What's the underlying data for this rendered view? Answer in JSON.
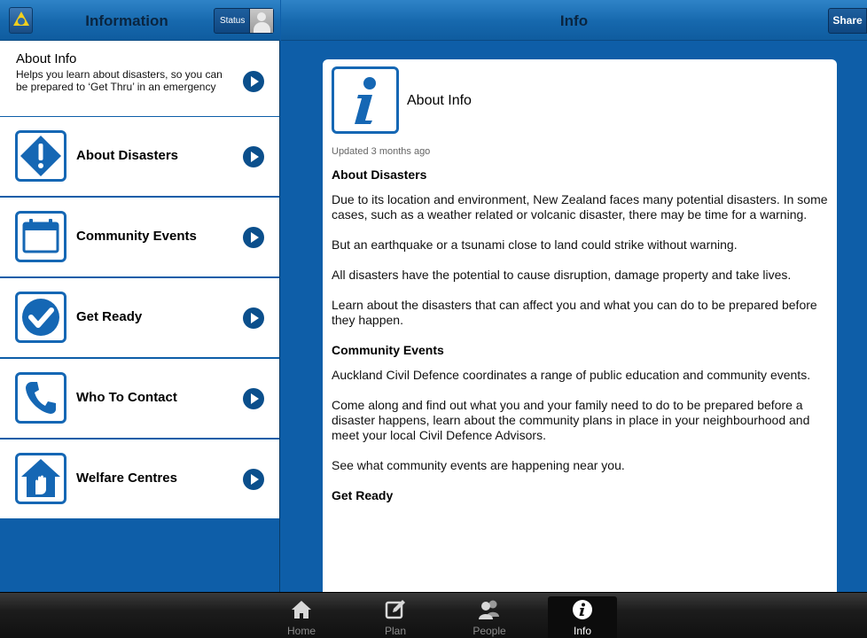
{
  "left_header": {
    "title": "Information",
    "status_label": "Status"
  },
  "intro": {
    "title": "About Info",
    "description": "Helps you learn about disasters, so you can be prepared to ‘Get Thru’ in an emergency"
  },
  "menu": [
    {
      "label": "About Disasters",
      "icon": "warning-diamond-icon"
    },
    {
      "label": "Community Events",
      "icon": "calendar-icon"
    },
    {
      "label": "Get Ready",
      "icon": "checkmark-icon"
    },
    {
      "label": "Who To Contact",
      "icon": "phone-icon"
    },
    {
      "label": "Welfare Centres",
      "icon": "house-hand-icon"
    }
  ],
  "right_header": {
    "title": "Info",
    "share_label": "Share"
  },
  "content": {
    "title": "About Info",
    "updated": "Updated 3 months ago",
    "sections": [
      {
        "heading": "About Disasters",
        "paragraphs": [
          "Due to its location and environment, New Zealand faces many potential disasters. In some cases, such as a weather related or volcanic disaster, there may be time for a warning.",
          "But an earthquake or a tsunami close to land could strike without warning.",
          "All disasters have the potential to cause disruption, damage property and take lives.",
          "Learn about the disasters that can affect you and what you can do to be prepared before they happen."
        ]
      },
      {
        "heading": "Community Events",
        "paragraphs": [
          "Auckland Civil Defence coordinates a range of public education and community events.",
          "Come along and find out what you and your family need to do to be prepared before a disaster happens, learn about the community plans in place in your neighbourhood and meet your local Civil Defence Advisors.",
          "See what community events are happening near you."
        ]
      },
      {
        "heading": "Get Ready",
        "paragraphs": []
      }
    ]
  },
  "tabbar": {
    "tabs": [
      {
        "label": "Home",
        "icon": "home-icon"
      },
      {
        "label": "Plan",
        "icon": "pencil-square-icon"
      },
      {
        "label": "People",
        "icon": "people-icon"
      },
      {
        "label": "Info",
        "icon": "info-icon"
      }
    ],
    "active": "Info"
  },
  "colors": {
    "brand_blue": "#1567b4",
    "background_blue": "#0e5ea8",
    "chevron": "#0b4f8c"
  }
}
